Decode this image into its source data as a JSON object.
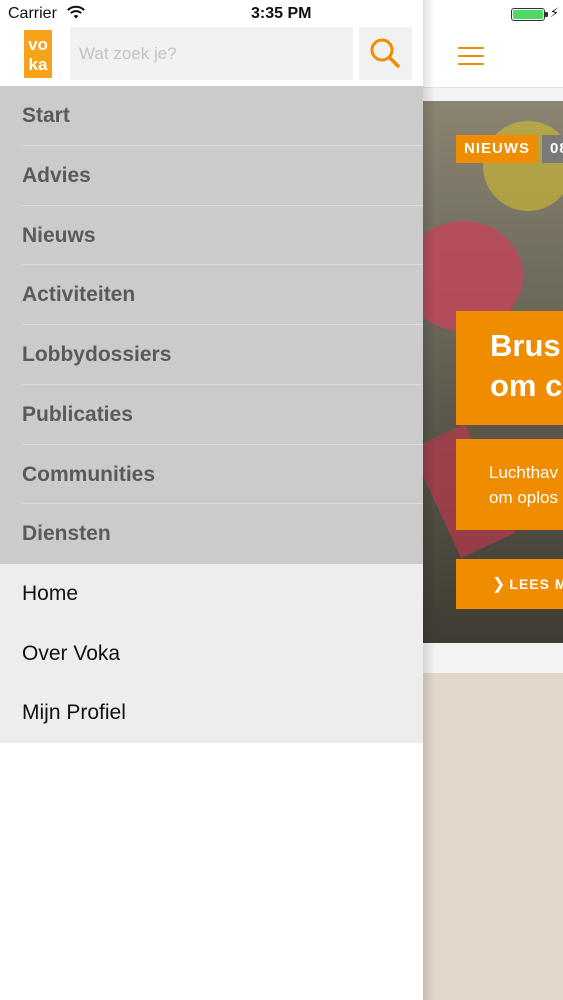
{
  "status_bar": {
    "carrier": "Carrier",
    "time": "3:35 PM",
    "wifi_icon": "wifi-icon",
    "battery_icon": "battery-charging-icon",
    "battery_color": "#4cd964"
  },
  "drawer": {
    "logo_text": "voka",
    "logo_icon": "voka-logo",
    "search": {
      "placeholder": "Wat zoek je?",
      "value": "",
      "button_icon": "search-icon"
    },
    "primary_menu": [
      {
        "label": "Start"
      },
      {
        "label": "Advies"
      },
      {
        "label": "Nieuws"
      },
      {
        "label": "Activiteiten"
      },
      {
        "label": "Lobbydossiers"
      },
      {
        "label": "Publicaties"
      },
      {
        "label": "Communities"
      },
      {
        "label": "Diensten"
      }
    ],
    "secondary_menu": [
      {
        "label": "Home"
      },
      {
        "label": "Over Voka"
      },
      {
        "label": "Mijn Profiel"
      }
    ]
  },
  "main": {
    "menu_icon": "hamburger-menu-icon",
    "hero": {
      "badge": "NIEUWS",
      "date_badge": "08",
      "headline_line1": "Brus",
      "headline_line2": "om c",
      "teaser_line1": "Luchthav",
      "teaser_line2": "om oplos",
      "read_more": "LEES M",
      "read_more_icon": "chevron-right-icon"
    }
  },
  "colors": {
    "accent": "#f08c00",
    "logo": "#f7a21b",
    "primary_menu_bg": "#cbcbcb",
    "primary_menu_text": "#5a5a5a",
    "secondary_menu_bg": "#ededed",
    "search_bg": "#f1f1f1"
  }
}
